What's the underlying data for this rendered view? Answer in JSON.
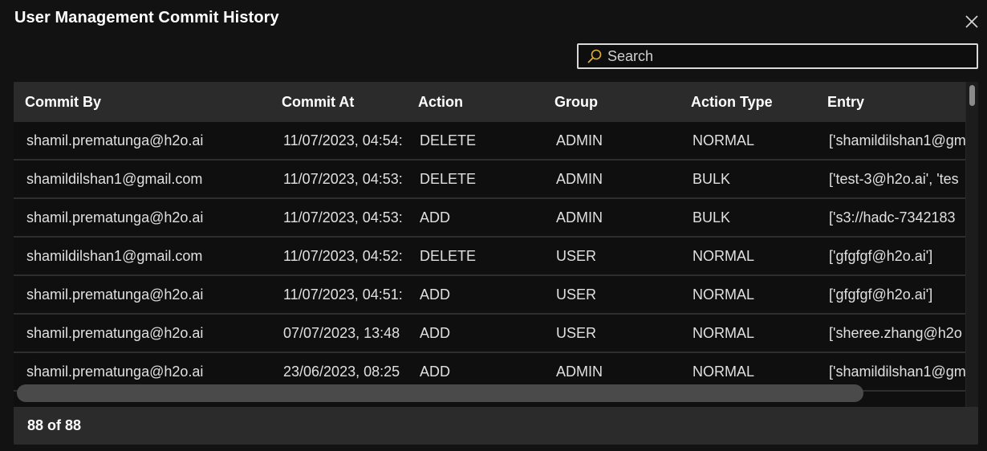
{
  "dialog": {
    "title": "User Management Commit History",
    "close_icon": "close-icon"
  },
  "search": {
    "placeholder": "Search",
    "value": "",
    "icon": "search-icon",
    "icon_color": "#e0b030"
  },
  "table": {
    "columns": [
      "Commit By",
      "Commit At",
      "Action",
      "Group",
      "Action Type",
      "Entry"
    ],
    "rows": [
      [
        "shamil.prematunga@h2o.ai",
        "11/07/2023, 04:54:",
        "DELETE",
        "ADMIN",
        "NORMAL",
        "['shamildilshan1@gm"
      ],
      [
        "shamildilshan1@gmail.com",
        "11/07/2023, 04:53:",
        "DELETE",
        "ADMIN",
        "BULK",
        "['test-3@h2o.ai', 'tes"
      ],
      [
        "shamil.prematunga@h2o.ai",
        "11/07/2023, 04:53:",
        "ADD",
        "ADMIN",
        "BULK",
        "['s3://hadc-7342183"
      ],
      [
        "shamildilshan1@gmail.com",
        "11/07/2023, 04:52:",
        "DELETE",
        "USER",
        "NORMAL",
        "['gfgfgf@h2o.ai']"
      ],
      [
        "shamil.prematunga@h2o.ai",
        "11/07/2023, 04:51:",
        "ADD",
        "USER",
        "NORMAL",
        "['gfgfgf@h2o.ai']"
      ],
      [
        "shamil.prematunga@h2o.ai",
        "07/07/2023, 13:48",
        "ADD",
        "USER",
        "NORMAL",
        "['sheree.zhang@h2o"
      ],
      [
        "shamil.prematunga@h2o.ai",
        "23/06/2023, 08:25",
        "ADD",
        "ADMIN",
        "NORMAL",
        "['shamildilshan1@gm"
      ]
    ],
    "footer": "88 of 88"
  }
}
